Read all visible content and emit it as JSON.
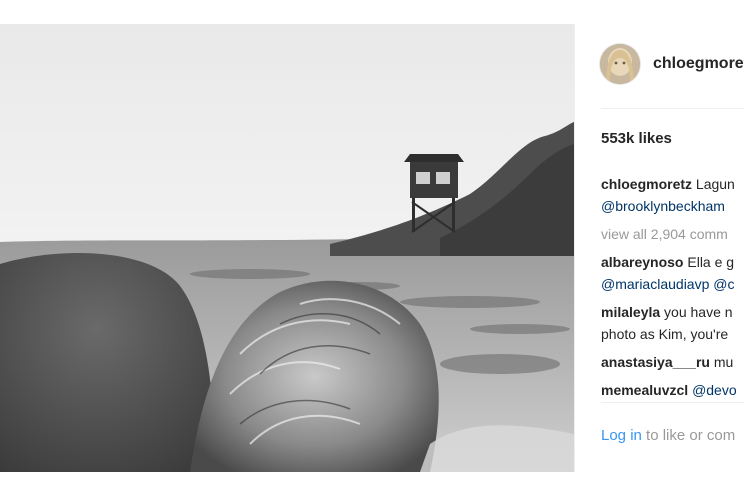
{
  "post": {
    "username": "chloegmoretz",
    "likes": "553k likes",
    "caption": {
      "user": "chloegmoretz",
      "text": "Lagun",
      "mention": "@brooklynbeckham"
    },
    "view_all": "view all 2,904 comm",
    "comments": [
      {
        "user": "albareynoso",
        "text": "Ella e g",
        "mentions": "@mariaclaudiavp @c"
      },
      {
        "user": "milaleyla",
        "text": "you have n",
        "line2": "photo as Kim, you're"
      },
      {
        "user": "anastasiya___ru",
        "text": "mu"
      },
      {
        "user": "memealuvzcl",
        "text": "",
        "mention": "@devo"
      }
    ],
    "login": {
      "link": "Log in",
      "text": "to like or com"
    }
  },
  "icons": {
    "avatar": "profile-photo",
    "photo": "beach-lifeguard-tower-photo"
  }
}
